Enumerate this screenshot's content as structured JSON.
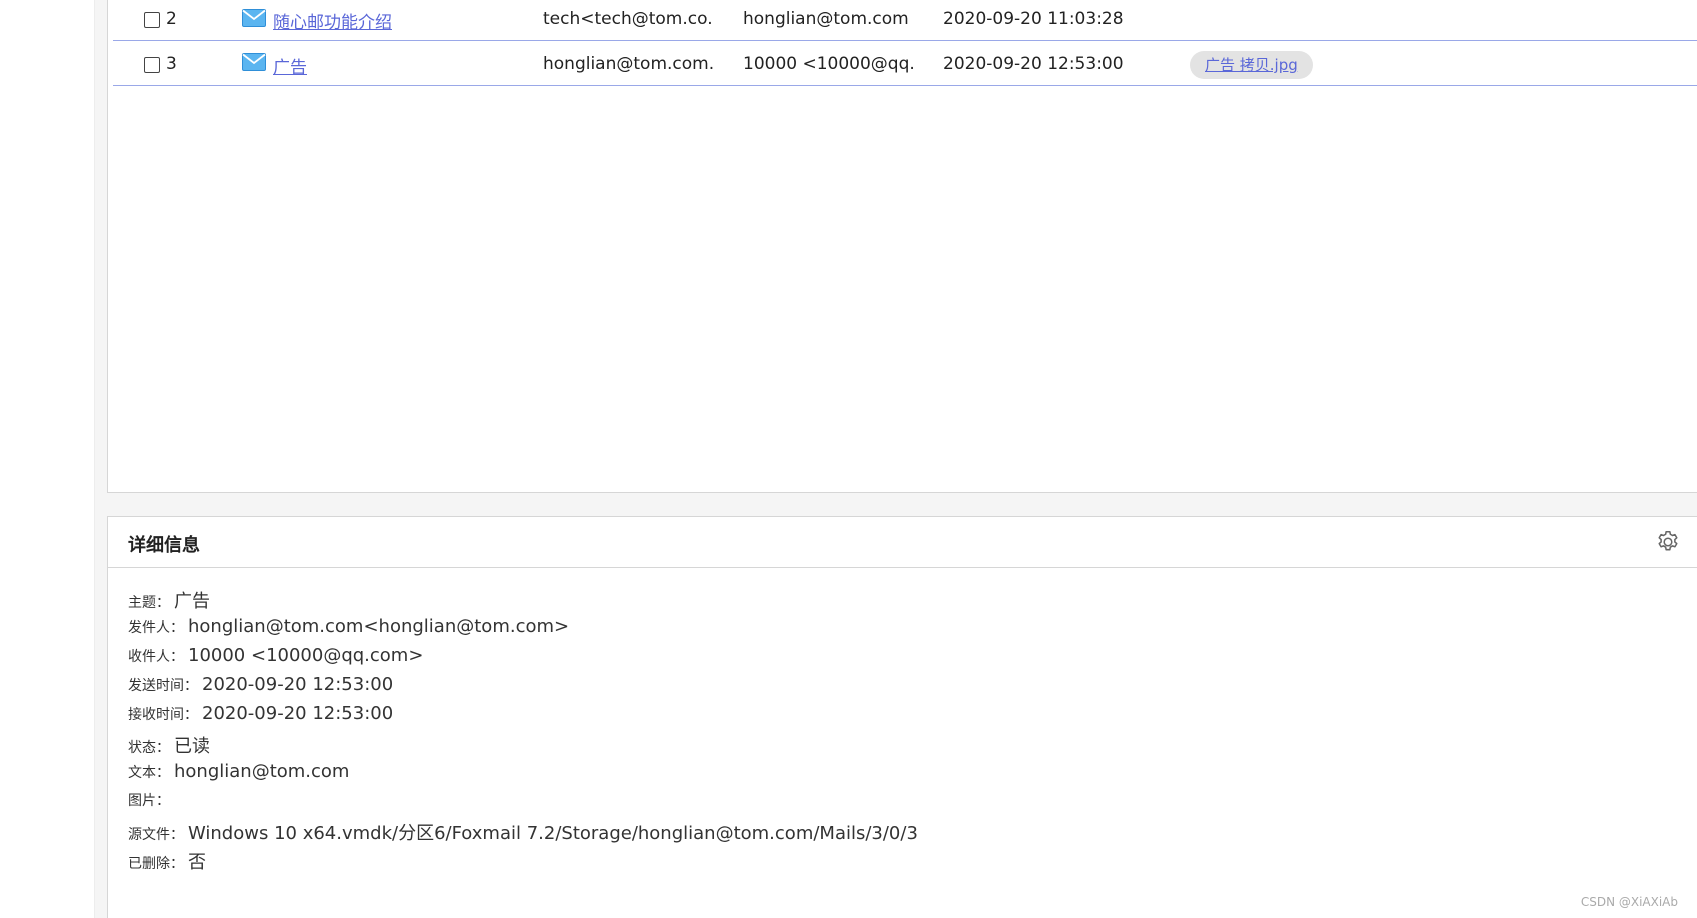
{
  "mail_list": {
    "rows": [
      {
        "num": "2",
        "subject": "随心邮功能介绍",
        "from": "tech<tech@tom.co...",
        "to": "honglian@tom.com",
        "time": "2020-09-20 11:03:28",
        "attachment": ""
      },
      {
        "num": "3",
        "subject": "广告",
        "from": "honglian@tom.com...",
        "to": "10000 <10000@qq....",
        "time": "2020-09-20 12:53:00",
        "attachment": "广告 拷贝.jpg"
      }
    ]
  },
  "detail": {
    "title": "详细信息",
    "fields": [
      {
        "label": "主题：",
        "value": "广告"
      },
      {
        "label": "发件人：",
        "value": "honglian@tom.com<honglian@tom.com>"
      },
      {
        "label": "收件人：",
        "value": "10000 <10000@qq.com>"
      },
      {
        "label": "发送时间：",
        "value": "2020-09-20 12:53:00"
      },
      {
        "label": "接收时间：",
        "value": "2020-09-20 12:53:00"
      },
      {
        "label": "状态：",
        "value": "已读"
      },
      {
        "label": "文本：",
        "value": "honglian@tom.com"
      },
      {
        "label": "图片：",
        "value": ""
      },
      {
        "label": "源文件：",
        "value": "Windows 10 x64.vmdk/分区6/Foxmail 7.2/Storage/honglian@tom.com/Mails/3/0/3"
      },
      {
        "label": "已删除：",
        "value": "否"
      }
    ]
  },
  "watermark": "CSDN @XiAXiAb",
  "icons": {
    "row_icon": "envelope-icon",
    "detail_settings": "gear-icon"
  },
  "colors": {
    "link": "#5a67d8",
    "row_divider": "#9aa8e8",
    "envelope": "#3aa0e8"
  }
}
